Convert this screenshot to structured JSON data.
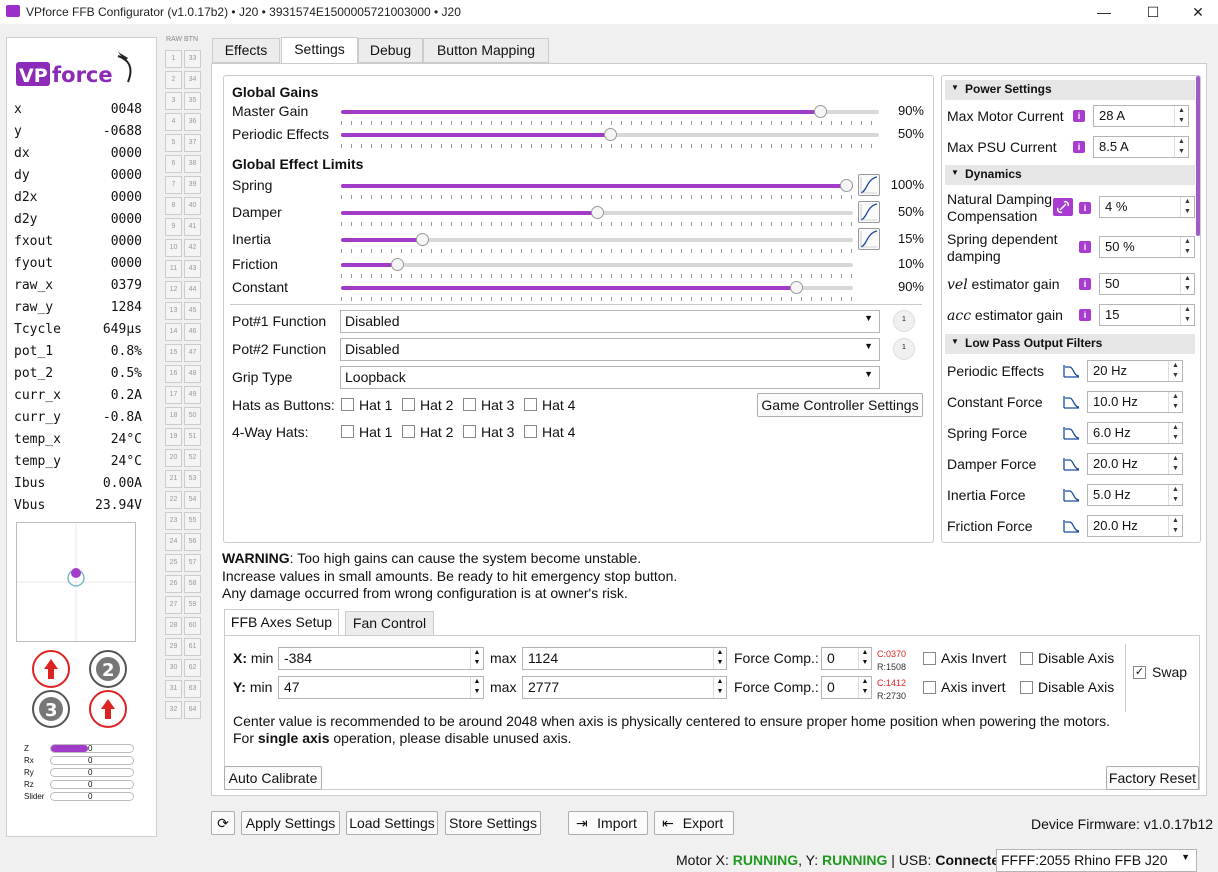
{
  "window": {
    "title": "VPforce FFB Configurator (v1.0.17b2) • J20 • 3931574E1500005721003000 • J20",
    "minimize": "—",
    "maximize": "☐",
    "close": "✕"
  },
  "logo": {
    "text": "VPforce"
  },
  "readouts": [
    {
      "k": "x",
      "v": "0048"
    },
    {
      "k": "y",
      "v": "-0688"
    },
    {
      "k": "dx",
      "v": "0000"
    },
    {
      "k": "dy",
      "v": "0000"
    },
    {
      "k": "d2x",
      "v": "0000"
    },
    {
      "k": "d2y",
      "v": "0000"
    },
    {
      "k": "fxout",
      "v": "0000"
    },
    {
      "k": "fyout",
      "v": "0000"
    },
    {
      "k": "raw_x",
      "v": "0379"
    },
    {
      "k": "raw_y",
      "v": "1284"
    },
    {
      "k": "Tcycle",
      "v": "649µs"
    },
    {
      "k": "pot_1",
      "v": "0.8%"
    },
    {
      "k": "pot_2",
      "v": "0.5%"
    },
    {
      "k": "curr_x",
      "v": "0.2A"
    },
    {
      "k": "curr_y",
      "v": "-0.8A"
    },
    {
      "k": "temp_x",
      "v": "24°C"
    },
    {
      "k": "temp_y",
      "v": "24°C"
    },
    {
      "k": "Ibus",
      "v": "0.00A"
    },
    {
      "k": "Vbus",
      "v": "23.94V"
    }
  ],
  "controller_buttons": {
    "b2": "2",
    "b3": "3"
  },
  "axes_bars": [
    {
      "label": "Z",
      "value": "0",
      "fill": 0.45
    },
    {
      "label": "Rx",
      "value": "0",
      "fill": 0
    },
    {
      "label": "Ry",
      "value": "0",
      "fill": 0
    },
    {
      "label": "Rz",
      "value": "0",
      "fill": 0
    },
    {
      "label": "Slider",
      "value": "0",
      "fill": 0
    }
  ],
  "button_grid": {
    "header": "RAW BTN",
    "left": [
      "1",
      "2",
      "3",
      "4",
      "5",
      "6",
      "7",
      "8",
      "9",
      "10",
      "11",
      "12",
      "13",
      "14",
      "15",
      "16",
      "17",
      "18",
      "19",
      "20",
      "21",
      "22",
      "23",
      "24",
      "25",
      "26",
      "27",
      "28",
      "29",
      "30",
      "31",
      "32"
    ],
    "right": [
      "33",
      "34",
      "35",
      "36",
      "37",
      "38",
      "39",
      "40",
      "41",
      "42",
      "43",
      "44",
      "45",
      "46",
      "47",
      "48",
      "49",
      "50",
      "51",
      "52",
      "53",
      "54",
      "55",
      "56",
      "57",
      "58",
      "59",
      "60",
      "61",
      "62",
      "63",
      "64"
    ]
  },
  "tabs": [
    "Effects",
    "Settings",
    "Debug",
    "Button Mapping"
  ],
  "global_gains": {
    "header": "Global Gains",
    "rows": [
      {
        "label": "Master Gain",
        "value": "90%",
        "level": 0.9
      },
      {
        "label": "Periodic Effects",
        "value": "50%",
        "level": 0.5
      }
    ]
  },
  "limits": {
    "header": "Global Effect Limits",
    "rows": [
      {
        "label": "Spring",
        "value": "100%",
        "level": 1.0
      },
      {
        "label": "Damper",
        "value": "50%",
        "level": 0.5
      },
      {
        "label": "Inertia",
        "value": "15%",
        "level": 0.15
      },
      {
        "label": "Friction",
        "value": "10%",
        "level": 0.1
      },
      {
        "label": "Constant",
        "value": "90%",
        "level": 0.9
      }
    ]
  },
  "pot1": {
    "label": "Pot#1 Function",
    "value": "Disabled",
    "knob": "1"
  },
  "pot2": {
    "label": "Pot#2 Function",
    "value": "Disabled",
    "knob": "1"
  },
  "grip": {
    "label": "Grip Type",
    "value": "Loopback"
  },
  "hats_buttons": {
    "label": "Hats as Buttons:",
    "items": [
      "Hat 1",
      "Hat 2",
      "Hat 3",
      "Hat 4"
    ]
  },
  "hats_4way": {
    "label": "4-Way Hats:",
    "items": [
      "Hat 1",
      "Hat 2",
      "Hat 3",
      "Hat 4"
    ]
  },
  "game_controller_settings": "Game Controller Settings",
  "power": {
    "header": "Power Settings",
    "max_motor": {
      "label": "Max Motor Current",
      "value": "28 A"
    },
    "max_psu": {
      "label": "Max PSU Current",
      "value": "8.5 A"
    }
  },
  "dynamics": {
    "header": "Dynamics",
    "natural": {
      "label1": "Natural Damping",
      "label2": "Compensation",
      "value": "4 %"
    },
    "spring_dep": {
      "label1": "Spring dependent",
      "label2": "damping",
      "value": "50 %"
    },
    "vel": {
      "label_pre": "vel",
      "label": " estimator gain",
      "value": "50"
    },
    "acc": {
      "label_pre": "acc",
      "label": " estimator gain",
      "value": "15"
    }
  },
  "lpf": {
    "header": "Low Pass Output Filters",
    "rows": [
      {
        "label": "Periodic Effects",
        "value": "20 Hz"
      },
      {
        "label": "Constant Force",
        "value": "10.0 Hz"
      },
      {
        "label": "Spring Force",
        "value": "6.0 Hz"
      },
      {
        "label": "Damper Force",
        "value": "20.0 Hz"
      },
      {
        "label": "Inertia Force",
        "value": "5.0 Hz"
      },
      {
        "label": "Friction Force",
        "value": "20.0 Hz"
      }
    ]
  },
  "warning": {
    "bold": "WARNING",
    "line1": ": Too high gains can cause the system become unstable.",
    "line2": "Increase values in small amounts. Be ready to hit emergency stop button.",
    "line3": "Any damage occurred from wrong configuration is at owner's risk."
  },
  "subtabs": [
    "FFB Axes Setup",
    "Fan Control"
  ],
  "xaxis": {
    "label": "X:",
    "min_label": "min",
    "min": "-384",
    "max_label": "max",
    "max": "1124",
    "fc_label": "Force Comp.:",
    "fc": "0",
    "c": "C:0370",
    "r": "R:1508",
    "invert": "Axis Invert",
    "disable": "Disable Axis"
  },
  "yaxis": {
    "label": "Y:",
    "min_label": "min",
    "min": "47",
    "max_label": "max",
    "max": "2777",
    "fc_label": "Force Comp.:",
    "fc": "0",
    "c": "C:1412",
    "r": "R:2730",
    "invert": "Axis invert",
    "disable": "Disable Axis"
  },
  "swap": "Swap",
  "note": {
    "line1": "Center value is recommended to be around 2048 when axis is physically centered to ensure proper home position when powering the motors.",
    "pre": "For ",
    "bold": "single axis",
    "post": " operation, please disable unused axis."
  },
  "auto_calibrate": "Auto Calibrate",
  "factory_reset": "Factory Reset",
  "bottom": {
    "refresh": "⟳",
    "apply": "Apply Settings",
    "load": "Load Settings",
    "store": "Store Settings",
    "import": "Import",
    "export": "Export",
    "firmware": "Device Firmware:  v1.0.17b12"
  },
  "status": {
    "motor_x_label": "Motor X: ",
    "motor_x": "RUNNING",
    "motor_y_label": ", Y: ",
    "motor_y": "RUNNING",
    "usb_label": " | USB: ",
    "usb": "Connected",
    "device": "FFFF:2055 Rhino FFB J20"
  }
}
